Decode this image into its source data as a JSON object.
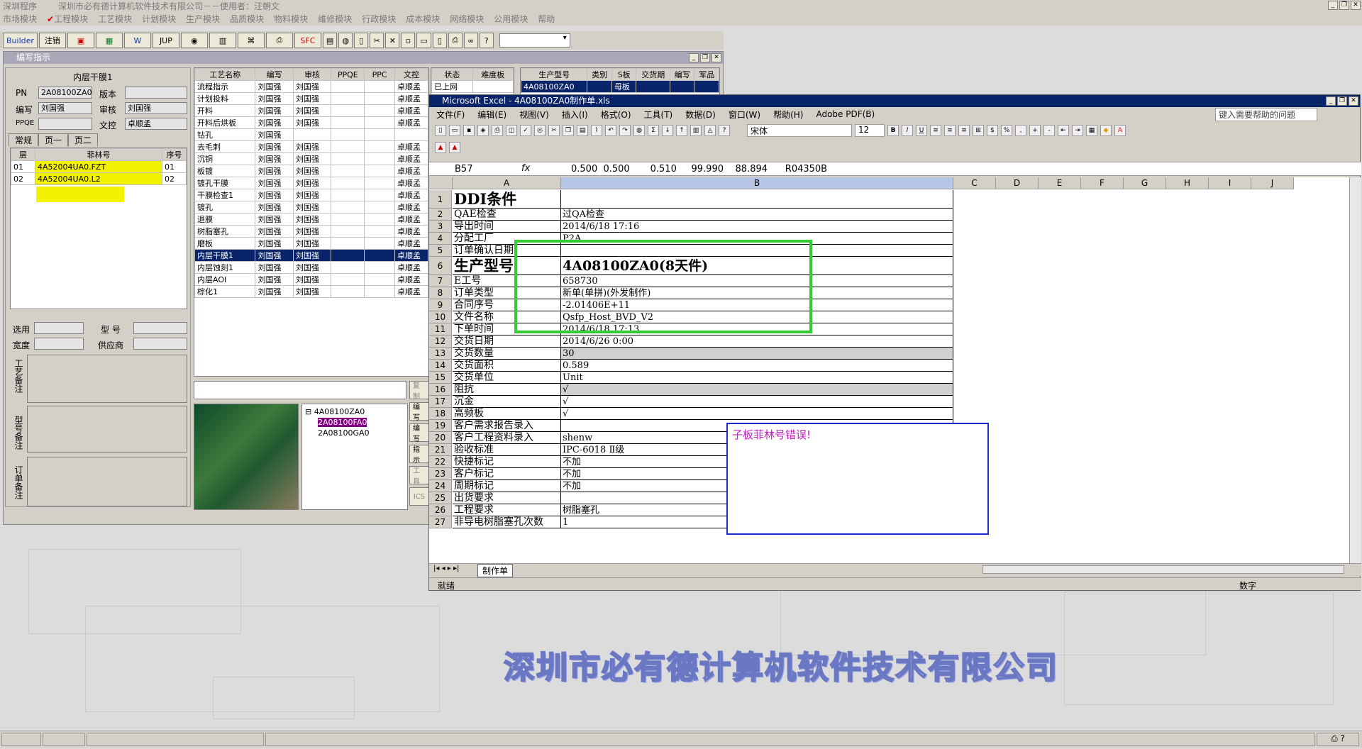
{
  "app": {
    "title": "深圳程序",
    "company_user": "深圳市必有德计算机软件技术有限公司－－使用者：汪朝文"
  },
  "menu": [
    "市场模块",
    "工程模块",
    "工艺模块",
    "计划模块",
    "生产模块",
    "品质模块",
    "物料模块",
    "维修模块",
    "行政模块",
    "成本模块",
    "网络模块",
    "公用模块",
    "帮助"
  ],
  "toolbar": {
    "builder": "Builder",
    "logout": "注销",
    "jup": "JUP",
    "spc": "SFC"
  },
  "left_window": {
    "title": "编写指示",
    "section_title": "内层干膜1",
    "fields": {
      "pn_label": "PN",
      "pn_value": "2A08100ZA0",
      "version_label": "版本",
      "version_value": "",
      "author_label": "编写",
      "author_value": "刘国强",
      "reviewer_label": "审核",
      "reviewer_value": "刘国强",
      "ppqe_label": "PPQE",
      "ppqe_value": "",
      "doc_control_label": "文控",
      "doc_control_value": "卓顺孟"
    },
    "tabs": [
      "常规",
      "页一",
      "页二"
    ],
    "layer_grid": {
      "headers": [
        "层",
        "菲林号",
        "序号"
      ],
      "rows": [
        [
          "01",
          "4A52004UA0.FZT",
          "01"
        ],
        [
          "02",
          "4A52004UA0.L2",
          "02"
        ]
      ]
    },
    "bottom_fields": {
      "select_label": "选用",
      "model_label": "型 号",
      "width_label": "宽度",
      "supplier_label": "供应商"
    },
    "notes": [
      "工艺备注",
      "型号备注",
      "订单备注"
    ],
    "process_grid": {
      "headers": [
        "工艺名称",
        "编写",
        "审核",
        "PPQE",
        "PPC",
        "文控",
        "状态",
        "难度板"
      ],
      "rows": [
        [
          "流程指示",
          "刘国强",
          "刘国强",
          "",
          "",
          "卓顺孟",
          "已上网",
          ""
        ],
        [
          "计划投料",
          "刘国强",
          "刘国强",
          "",
          "",
          "卓顺孟",
          "",
          ""
        ],
        [
          "开料",
          "刘国强",
          "刘国强",
          "",
          "",
          "卓顺孟",
          "",
          ""
        ],
        [
          "开料后烘板",
          "刘国强",
          "刘国强",
          "",
          "",
          "卓顺孟",
          "",
          ""
        ],
        [
          "钻孔",
          "刘国强",
          "",
          "",
          "",
          "",
          "",
          ""
        ],
        [
          "去毛刺",
          "刘国强",
          "刘国强",
          "",
          "",
          "卓顺孟",
          "",
          ""
        ],
        [
          "沉铜",
          "刘国强",
          "刘国强",
          "",
          "",
          "卓顺孟",
          "",
          ""
        ],
        [
          "板镀",
          "刘国强",
          "刘国强",
          "",
          "",
          "卓顺孟",
          "",
          ""
        ],
        [
          "镀孔干膜",
          "刘国强",
          "刘国强",
          "",
          "",
          "卓顺孟",
          "",
          ""
        ],
        [
          "干膜检查1",
          "刘国强",
          "刘国强",
          "",
          "",
          "卓顺孟",
          "",
          ""
        ],
        [
          "镀孔",
          "刘国强",
          "刘国强",
          "",
          "",
          "卓顺孟",
          "",
          ""
        ],
        [
          "退膜",
          "刘国强",
          "刘国强",
          "",
          "",
          "卓顺孟",
          "",
          ""
        ],
        [
          "树脂塞孔",
          "刘国强",
          "刘国强",
          "",
          "",
          "卓顺孟",
          "",
          ""
        ],
        [
          "磨板",
          "刘国强",
          "刘国强",
          "",
          "",
          "卓顺孟",
          "",
          ""
        ],
        [
          "内层干膜1",
          "刘国强",
          "刘国强",
          "",
          "",
          "卓顺孟",
          "",
          ""
        ],
        [
          "内层蚀刻1",
          "刘国强",
          "刘国强",
          "",
          "",
          "卓顺孟",
          "",
          ""
        ],
        [
          "内层AOI",
          "刘国强",
          "刘国强",
          "",
          "",
          "卓顺孟",
          "",
          ""
        ],
        [
          "棕化1",
          "刘国强",
          "刘国强",
          "",
          "",
          "卓顺孟",
          "",
          ""
        ]
      ],
      "selected_index": 14
    },
    "product_grid": {
      "headers": [
        "生产型号",
        "类别",
        "S板",
        "交货期",
        "编写",
        "军品"
      ],
      "rows": [
        [
          "4A08100ZA0",
          "",
          "母板",
          "",
          "",
          ""
        ]
      ]
    },
    "tree": {
      "root": "4A08100ZA0",
      "children": [
        "2A08100FA0",
        "2A08100GA0"
      ]
    },
    "side_buttons": [
      "复制",
      "编写",
      "编写",
      "指示",
      "工具",
      "ICS"
    ]
  },
  "excel": {
    "title": "Microsoft Excel - 4A08100ZA0制作单.xls",
    "menu": [
      "文件(F)",
      "编辑(E)",
      "视图(V)",
      "插入(I)",
      "格式(O)",
      "工具(T)",
      "数据(D)",
      "窗口(W)",
      "帮助(H)",
      "Adobe PDF(B)"
    ],
    "help_placeholder": "键入需要帮助的问题",
    "font_name": "宋体",
    "font_size": "12",
    "name_box": "B57",
    "formula": "0.500  0.500       0.510     99.990    88.894      R04350B",
    "columns": [
      "A",
      "B",
      "C",
      "D",
      "E",
      "F",
      "G",
      "H",
      "I",
      "J"
    ],
    "rows": [
      {
        "n": "1",
        "a": "DDI条件",
        "b": ""
      },
      {
        "n": "2",
        "a": "QAE检查",
        "b": "过QA检查"
      },
      {
        "n": "3",
        "a": "导出时间",
        "b": "2014/6/18 17:16"
      },
      {
        "n": "4",
        "a": "分配工厂",
        "b": "P2A"
      },
      {
        "n": "5",
        "a": "订单确认日期",
        "b": ""
      },
      {
        "n": "6",
        "a": "生产型号",
        "b": "4A08100ZA0(8天件)"
      },
      {
        "n": "7",
        "a": "E工号",
        "b": "658730"
      },
      {
        "n": "8",
        "a": "订单类型",
        "b": "新单(单拼)(外发制作)"
      },
      {
        "n": "9",
        "a": "合同序号",
        "b": "-2.01406E+11"
      },
      {
        "n": "10",
        "a": "文件名称",
        "b": "Qsfp_Host_BVD_V2"
      },
      {
        "n": "11",
        "a": "下单时间",
        "b": "2014/6/18 17:13"
      },
      {
        "n": "12",
        "a": "交货日期",
        "b": "2014/6/26 0:00"
      },
      {
        "n": "13",
        "a": "交货数量",
        "b": "30"
      },
      {
        "n": "14",
        "a": "交货面积",
        "b": "0.589"
      },
      {
        "n": "15",
        "a": "交货单位",
        "b": "Unit"
      },
      {
        "n": "16",
        "a": "阻抗",
        "b": "√"
      },
      {
        "n": "17",
        "a": "沉金",
        "b": "√"
      },
      {
        "n": "18",
        "a": "高频板",
        "b": "√"
      },
      {
        "n": "19",
        "a": "客户需求报告录入",
        "b": ""
      },
      {
        "n": "20",
        "a": "客户工程资料录入",
        "b": "shenw"
      },
      {
        "n": "21",
        "a": "验收标准",
        "b": "IPC-6018 Ⅱ级"
      },
      {
        "n": "22",
        "a": "快捷标记",
        "b": "不加"
      },
      {
        "n": "23",
        "a": "客户标记",
        "b": "不加"
      },
      {
        "n": "24",
        "a": "周期标记",
        "b": "不加"
      },
      {
        "n": "25",
        "a": "出货要求",
        "b": ""
      },
      {
        "n": "26",
        "a": "工程要求",
        "b": "树脂塞孔"
      },
      {
        "n": "27",
        "a": "非导电树脂塞孔次数",
        "b": "1"
      }
    ],
    "sheet_tab": "制作单",
    "status_left": "就绪",
    "status_right": "数字",
    "comment": "子板菲林号错误!"
  },
  "desktop_company": "深圳市必有德计算机软件技术有限公司"
}
